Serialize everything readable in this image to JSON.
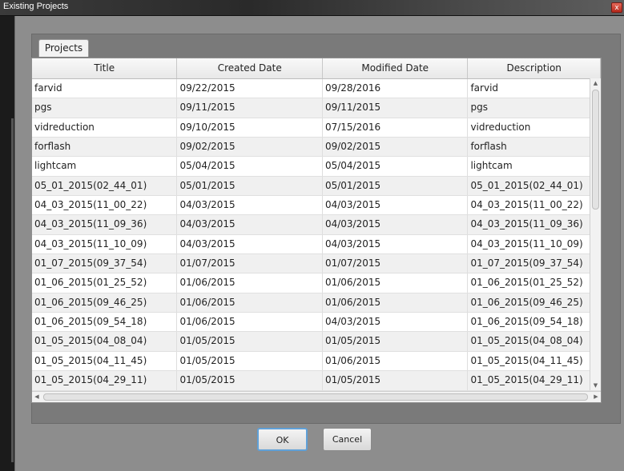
{
  "window": {
    "title": "Existing Projects",
    "close_glyph": "x"
  },
  "tabs": [
    {
      "label": "Projects"
    }
  ],
  "table": {
    "columns": [
      "Title",
      "Created Date",
      "Modified Date",
      "Description"
    ],
    "rows": [
      [
        "farvid",
        "09/22/2015",
        "09/28/2016",
        "farvid"
      ],
      [
        "pgs",
        "09/11/2015",
        "09/11/2015",
        "pgs"
      ],
      [
        "vidreduction",
        "09/10/2015",
        "07/15/2016",
        "vidreduction"
      ],
      [
        "forflash",
        "09/02/2015",
        "09/02/2015",
        "forflash"
      ],
      [
        "lightcam",
        "05/04/2015",
        "05/04/2015",
        "lightcam"
      ],
      [
        "05_01_2015(02_44_01)",
        "05/01/2015",
        "05/01/2015",
        "05_01_2015(02_44_01)"
      ],
      [
        "04_03_2015(11_00_22)",
        "04/03/2015",
        "04/03/2015",
        "04_03_2015(11_00_22)"
      ],
      [
        "04_03_2015(11_09_36)",
        "04/03/2015",
        "04/03/2015",
        "04_03_2015(11_09_36)"
      ],
      [
        "04_03_2015(11_10_09)",
        "04/03/2015",
        "04/03/2015",
        "04_03_2015(11_10_09)"
      ],
      [
        "01_07_2015(09_37_54)",
        "01/07/2015",
        "01/07/2015",
        "01_07_2015(09_37_54)"
      ],
      [
        "01_06_2015(01_25_52)",
        "01/06/2015",
        "01/06/2015",
        "01_06_2015(01_25_52)"
      ],
      [
        "01_06_2015(09_46_25)",
        "01/06/2015",
        "01/06/2015",
        "01_06_2015(09_46_25)"
      ],
      [
        "01_06_2015(09_54_18)",
        "01/06/2015",
        "04/03/2015",
        "01_06_2015(09_54_18)"
      ],
      [
        "01_05_2015(04_08_04)",
        "01/05/2015",
        "01/05/2015",
        "01_05_2015(04_08_04)"
      ],
      [
        "01_05_2015(04_11_45)",
        "01/05/2015",
        "01/06/2015",
        "01_05_2015(04_11_45)"
      ],
      [
        "01_05_2015(04_29_11)",
        "01/05/2015",
        "01/05/2015",
        "01_05_2015(04_29_11)"
      ]
    ]
  },
  "buttons": {
    "ok": "OK",
    "cancel": "Cancel"
  },
  "icons": {
    "close": "close-icon",
    "scroll_up": "chevron-up-icon",
    "scroll_down": "chevron-down-icon",
    "scroll_left": "chevron-left-icon",
    "scroll_right": "chevron-right-icon"
  },
  "colors": {
    "focus_border": "#5fa0d8",
    "dialog_background": "#8d8d8d",
    "close_button": "#c0392b"
  }
}
